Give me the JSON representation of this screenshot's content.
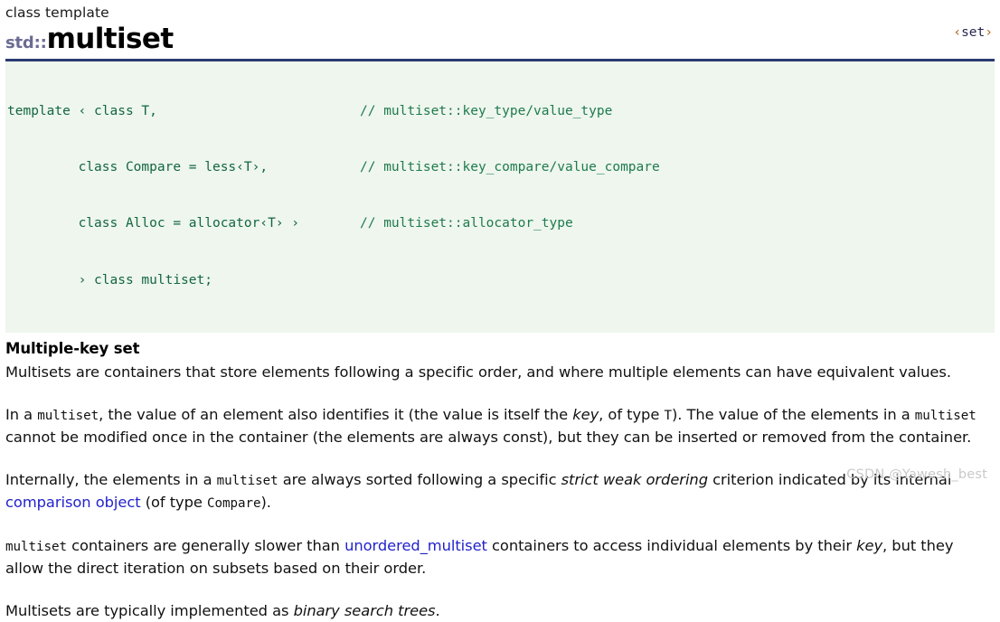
{
  "header": {
    "kind_label": "class template",
    "namespace": "std::",
    "class_name": "multiset",
    "header_link": {
      "open_bracket": "‹",
      "name": "set",
      "close_bracket": "›",
      "full_text": "<set>"
    }
  },
  "code_block": {
    "language": "cpp",
    "lines": [
      {
        "code": "template ‹ class T,",
        "comment": "// multiset::key_type/value_type"
      },
      {
        "code": "         class Compare = less‹T›,",
        "comment": "// multiset::key_compare/value_compare"
      },
      {
        "code": "         class Alloc = allocator‹T› ›",
        "comment": "// multiset::allocator_type"
      },
      {
        "code": "         › class multiset;",
        "comment": ""
      }
    ]
  },
  "content": {
    "subheading": "Multiple-key set",
    "paragraphs": {
      "p1": {
        "s1": "Multisets are containers that store elements following a specific order, and where multiple elements can have equivalent values."
      },
      "p2": {
        "s1": "In a ",
        "code1": "multiset",
        "s2": ", the value of an element also identifies it (the value is itself the ",
        "ital1": "key",
        "s3": ", of type ",
        "code2": "T",
        "s4": "). The value of the elements in a ",
        "code3": "multiset",
        "s5": " cannot be modified once in the container (the elements are always const), but they can be inserted or removed from the container."
      },
      "p3": {
        "s1": "Internally, the elements in a ",
        "code1": "multiset",
        "s2": " are always sorted following a specific ",
        "ital1": "strict weak ordering",
        "s3": " criterion indicated by its internal ",
        "link1": "comparison object",
        "s4": " (of type ",
        "code2": "Compare",
        "s5": ")."
      },
      "p4": {
        "code1": "multiset",
        "s1": " containers are generally slower than ",
        "link1": "unordered_multiset",
        "s2": " containers to access individual elements by their ",
        "ital1": "key",
        "s3": ", but they allow the direct iteration on subsets based on their order."
      },
      "p5": {
        "s1": "Multisets are typically implemented as ",
        "ital1": "binary search trees",
        "s2": "."
      }
    }
  },
  "watermark": {
    "text": "CSDN @Yawesh_best"
  },
  "colors": {
    "rule": "#2a3b72",
    "code_background": "#eef6ee",
    "code_text": "#14663f",
    "code_comment": "#1f7a4d",
    "link": "#2222cc",
    "namespace_prefix": "#6b6b93",
    "watermark": "#c9c9c9"
  }
}
